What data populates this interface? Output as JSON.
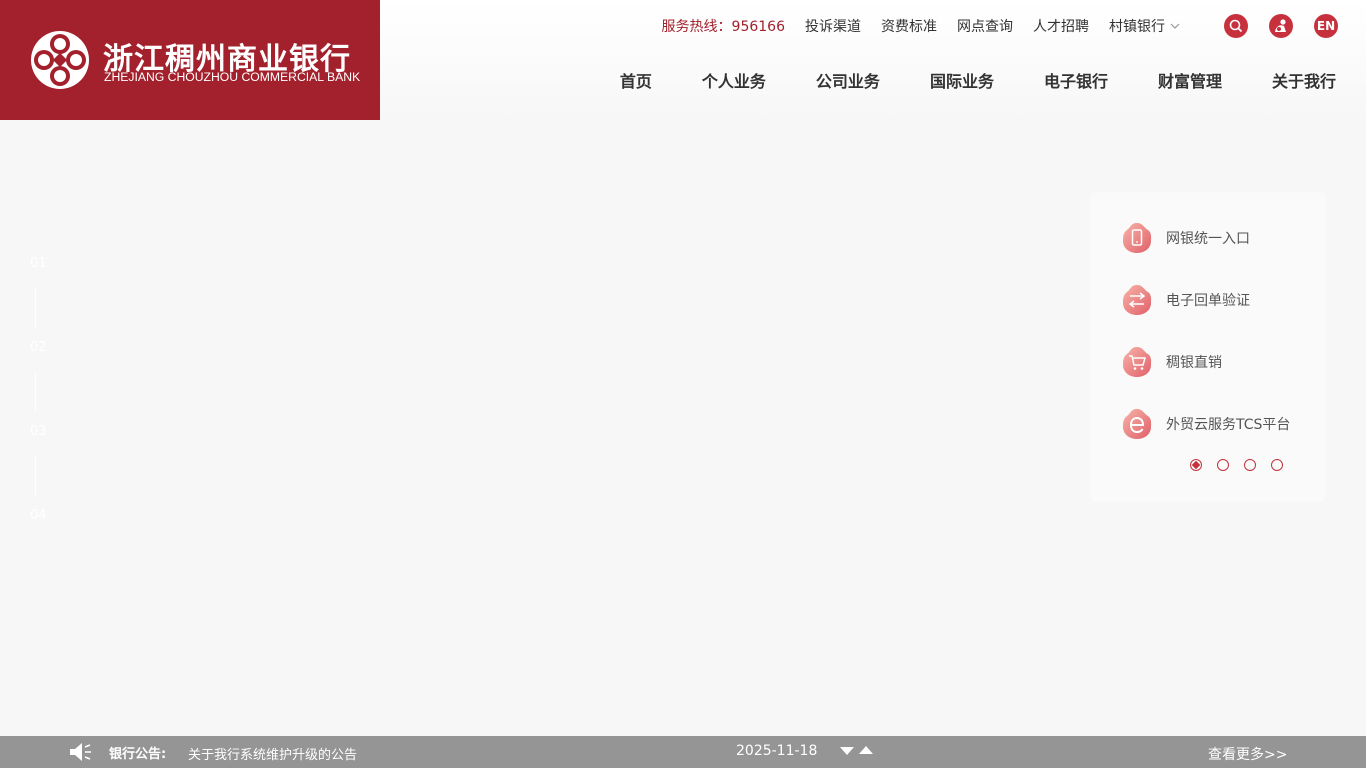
{
  "brand": {
    "name_cn": "浙江稠州商业银行",
    "name_en": "ZHEJIANG CHOUZHOU COMMERCIAL BANK",
    "color": "#a3212c",
    "logo_icon": "bank-emblem-icon"
  },
  "toplinks": {
    "hotline": "服务热线：956166",
    "items": [
      "投诉渠道",
      "资费标准",
      "网点查询",
      "人才招聘"
    ],
    "village": "村镇银行",
    "icons": [
      "search-icon",
      "accessibility-icon"
    ],
    "lang": "EN"
  },
  "nav": {
    "items": [
      "首页",
      "个人业务",
      "公司业务",
      "国际业务",
      "电子银行",
      "财富管理",
      "关于我行"
    ]
  },
  "slides": {
    "numbers": [
      "01",
      "02",
      "03",
      "04"
    ],
    "active": 0
  },
  "quick": {
    "items": [
      {
        "label": "网银统一入口",
        "icon": "phone-icon"
      },
      {
        "label": "电子回单验证",
        "icon": "receipt-verify-icon"
      },
      {
        "label": "稠银直销",
        "icon": "cart-icon"
      },
      {
        "label": "外贸云服务TCS平台",
        "icon": "e-letter-icon"
      }
    ],
    "page_count": 4,
    "active_page": 0,
    "accent": "#c6313d"
  },
  "notice": {
    "label": "银行公告:",
    "text": "关于我行系统维护升级的公告",
    "date": "2025-11-18",
    "more": "查看更多>>",
    "bar_color": "#959595"
  }
}
